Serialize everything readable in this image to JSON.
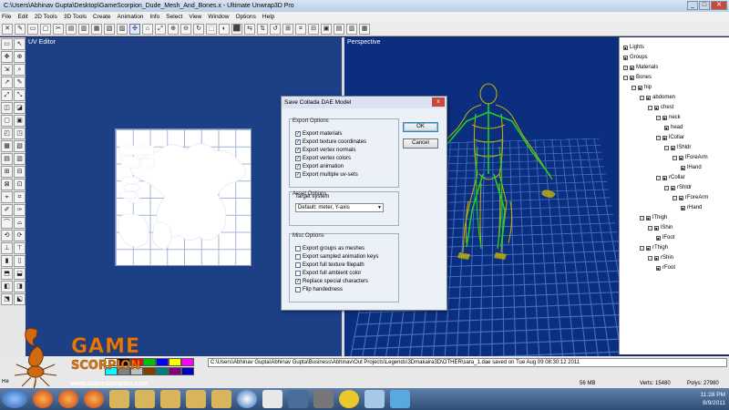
{
  "window": {
    "title": "C:\\Users\\Abhinav Gupta\\Desktop\\GameScorpion_Dude_Mesh_And_Bones.x - Ultimate Unwrap3D Pro",
    "minimize": "_",
    "maximize": "□",
    "close": "✕"
  },
  "menu": [
    "File",
    "Edit",
    "2D Tools",
    "3D Tools",
    "Create",
    "Animation",
    "Info",
    "Select",
    "View",
    "Window",
    "Options",
    "Help"
  ],
  "toolbar_icons": [
    "✕",
    "✎",
    "▭",
    "▢",
    "✂",
    "▤",
    "▥",
    "▦",
    "▧",
    "▨",
    "✣",
    "⌂",
    "⤢",
    "⊕",
    "⊖",
    "↻",
    "⬚",
    "◐",
    "⬛",
    "⇆",
    "⇅",
    "↺",
    "⊞",
    "⌗",
    "⊟",
    "▣",
    "▤",
    "▥",
    "▦"
  ],
  "left_tools": [
    "▭",
    "↖",
    "✥",
    "⊕",
    "⇲",
    "⌕",
    "↗",
    "✎",
    "⤢",
    "⤡",
    "◫",
    "◪",
    "▢",
    "▣",
    "◰",
    "◳",
    "▦",
    "▧",
    "▤",
    "▥",
    "⊞",
    "⊟",
    "⊠",
    "⊡",
    "⌖",
    "⌗",
    "✐",
    "✑",
    "⌒",
    "⌓",
    "⟲",
    "⟳",
    "⊥",
    "⊤",
    "▮",
    "▯",
    "⬒",
    "⬓",
    "◧",
    "◨",
    "⬔",
    "⬕"
  ],
  "panels": {
    "uv": "UV Editor",
    "perspective": "Perspective"
  },
  "dialog": {
    "title": "Save Collada DAE Model",
    "close": "x",
    "export_options_label": "Export Options",
    "export_options": [
      {
        "label": "Export materials",
        "checked": true
      },
      {
        "label": "Export texture coordinates",
        "checked": true
      },
      {
        "label": "Export vertex normals",
        "checked": true
      },
      {
        "label": "Export vertex colors",
        "checked": true
      },
      {
        "label": "Export animation",
        "checked": true
      },
      {
        "label": "Export multiple uv-sets",
        "checked": true
      }
    ],
    "asset_options_label": "Asset Options",
    "target_system_label": "Target system",
    "target_system_value": "Default: meter, Y-axis",
    "misc_options_label": "Misc Options",
    "misc_options": [
      {
        "label": "Export groups as meshes",
        "checked": false
      },
      {
        "label": "Export sampled animation keys",
        "checked": false
      },
      {
        "label": "Export full texture filepath",
        "checked": false
      },
      {
        "label": "Export full ambient color",
        "checked": false
      },
      {
        "label": "Replace special characters",
        "checked": true
      },
      {
        "label": "Flip handedness",
        "checked": false
      }
    ],
    "ok": "OK",
    "cancel": "Cancel"
  },
  "tree": [
    {
      "label": "Lights",
      "level": 0,
      "toggle": "",
      "box": "■"
    },
    {
      "label": "Groups",
      "level": 0,
      "toggle": "",
      "box": "■"
    },
    {
      "label": "Materials",
      "level": 0,
      "toggle": "+",
      "box": "■"
    },
    {
      "label": "Bones",
      "level": 0,
      "toggle": "−",
      "box": "■"
    },
    {
      "label": "hip",
      "level": 1,
      "toggle": "−",
      "box": "■"
    },
    {
      "label": "abdomen",
      "level": 2,
      "toggle": "−",
      "box": "■"
    },
    {
      "label": "chest",
      "level": 3,
      "toggle": "−",
      "box": "■"
    },
    {
      "label": "neck",
      "level": 4,
      "toggle": "−",
      "box": "■"
    },
    {
      "label": "head",
      "level": 5,
      "toggle": "",
      "box": "■"
    },
    {
      "label": "lCollar",
      "level": 4,
      "toggle": "−",
      "box": "■"
    },
    {
      "label": "lShldr",
      "level": 5,
      "toggle": "−",
      "box": "■"
    },
    {
      "label": "lForeArm",
      "level": 6,
      "toggle": "−",
      "box": "■"
    },
    {
      "label": "lHand",
      "level": 7,
      "toggle": "",
      "box": "■"
    },
    {
      "label": "rCollar",
      "level": 4,
      "toggle": "−",
      "box": "■"
    },
    {
      "label": "rShldr",
      "level": 5,
      "toggle": "−",
      "box": "■"
    },
    {
      "label": "rForeArm",
      "level": 6,
      "toggle": "−",
      "box": "■"
    },
    {
      "label": "rHand",
      "level": 7,
      "toggle": "",
      "box": "■"
    },
    {
      "label": "lThigh",
      "level": 2,
      "toggle": "−",
      "box": "■"
    },
    {
      "label": "lShin",
      "level": 3,
      "toggle": "−",
      "box": "■"
    },
    {
      "label": "lFoot",
      "level": 4,
      "toggle": "",
      "box": "■"
    },
    {
      "label": "rThigh",
      "level": 2,
      "toggle": "−",
      "box": "■"
    },
    {
      "label": "rShin",
      "level": 3,
      "toggle": "−",
      "box": "■"
    },
    {
      "label": "rFoot",
      "level": 4,
      "toggle": "",
      "box": "■"
    }
  ],
  "palette_colors": [
    "#ffffff",
    "#000000",
    "#ff0000",
    "#00c000",
    "#0000ff",
    "#ffff00",
    "#ff00ff",
    "#00ffff",
    "#808080",
    "#c0c0c0",
    "#804000",
    "#008080",
    "#800080",
    "#0000c0"
  ],
  "bottom": {
    "path": "C:\\Users\\Abhinav Gupta\\Abhinav Gupta\\Business\\Abhinav\\Out Projects\\Legends\\3Dmakaira3D\\OTHER\\sara_1.dae saved on Tue Aug 09 08:30:12 2011",
    "ready": "Re",
    "memory": "56 MB",
    "verts": "Verts: 15480",
    "polys": "Polys: 27980"
  },
  "logo": {
    "game": "GAME",
    "sub": "SCORPION",
    "url": "www.GameScorpion.com"
  },
  "taskbar": {
    "time": "11:28 PM",
    "date": "8/9/2011"
  },
  "colors": {
    "uv_bg": "#1d3f86",
    "persp_bg": "#0c2e7f",
    "grid": "#3f73c8",
    "wire": "#c8b400",
    "bone": "#1fd11f",
    "logo": "#e07a10"
  }
}
